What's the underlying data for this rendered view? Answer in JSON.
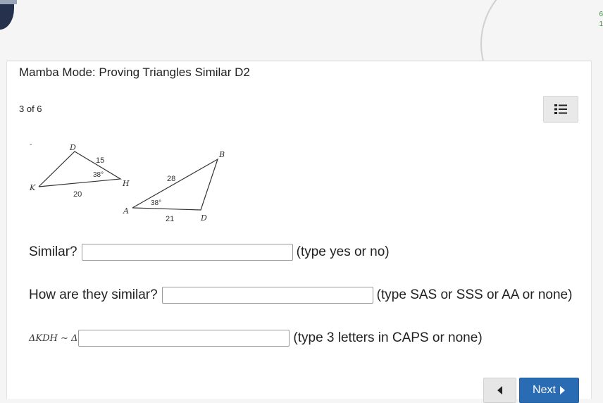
{
  "top": {
    "right_text": "6\n1"
  },
  "header": {
    "title": "Mamba Mode: Proving Triangles Similar D2",
    "counter": "3 of 6",
    "menu_icon": "list-icon"
  },
  "figure": {
    "triangle1": {
      "vertices": [
        "K",
        "D",
        "H"
      ],
      "side_DH": "15",
      "side_KH": "20",
      "angle_H": "38°"
    },
    "triangle2": {
      "vertices": [
        "A",
        "B",
        "D"
      ],
      "side_AB": "28",
      "side_AD": "21",
      "angle_A": "38°"
    }
  },
  "questions": [
    {
      "label": "Similar?",
      "value": "",
      "hint": "(type yes or no)"
    },
    {
      "label": "How are they similar?",
      "value": "",
      "hint": "(type SAS or SSS or AA or none)"
    },
    {
      "label": "ΔKDH ∼ Δ",
      "value": "",
      "hint": "(type 3 letters in CAPS or none)"
    }
  ],
  "nav": {
    "prev_icon": "caret-left-icon",
    "next_label": "Next",
    "next_icon": "caret-right-icon"
  },
  "colors": {
    "next_button": "#2a6cb4",
    "background": "#f5f5f5",
    "card": "#ffffff"
  }
}
